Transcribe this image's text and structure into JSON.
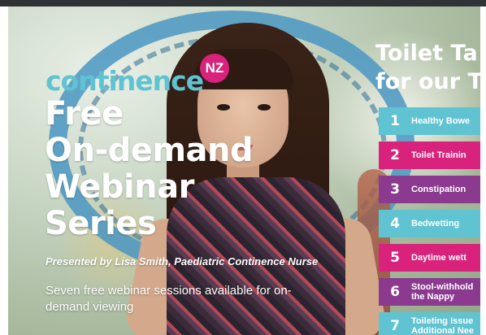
{
  "colors": {
    "brand_teal": "#5fc3d1",
    "brand_pink": "#d9227b",
    "brand_purple": "#8b3a8f"
  },
  "logo": {
    "word": "continence",
    "badge": "NZ"
  },
  "headline": {
    "line1": "Free",
    "line2": "On-demand",
    "line3": "Webinar",
    "line4": "Series"
  },
  "presenter": "Presented by Lisa Smith, Paediatric Continence Nurse",
  "description": "Seven free webinar sessions available for on-demand viewing",
  "series_title": {
    "line1": "Toilet Ta",
    "line2": "for our T"
  },
  "topics": [
    {
      "num": "1",
      "label": "Healthy Bowe",
      "color": "#5fc3d1"
    },
    {
      "num": "2",
      "label": "Toilet Trainin",
      "color": "#d9227b"
    },
    {
      "num": "3",
      "label": "Constipation",
      "color": "#8b3a8f"
    },
    {
      "num": "4",
      "label": "Bedwetting",
      "color": "#5fc3d1"
    },
    {
      "num": "5",
      "label": "Daytime wett",
      "color": "#d9227b"
    },
    {
      "num": "6",
      "label": "Stool-withhold the Nappy",
      "color": "#8b3a8f"
    },
    {
      "num": "7",
      "label": "Toileting Issue Additional Nee",
      "color": "#5fc3d1"
    }
  ]
}
